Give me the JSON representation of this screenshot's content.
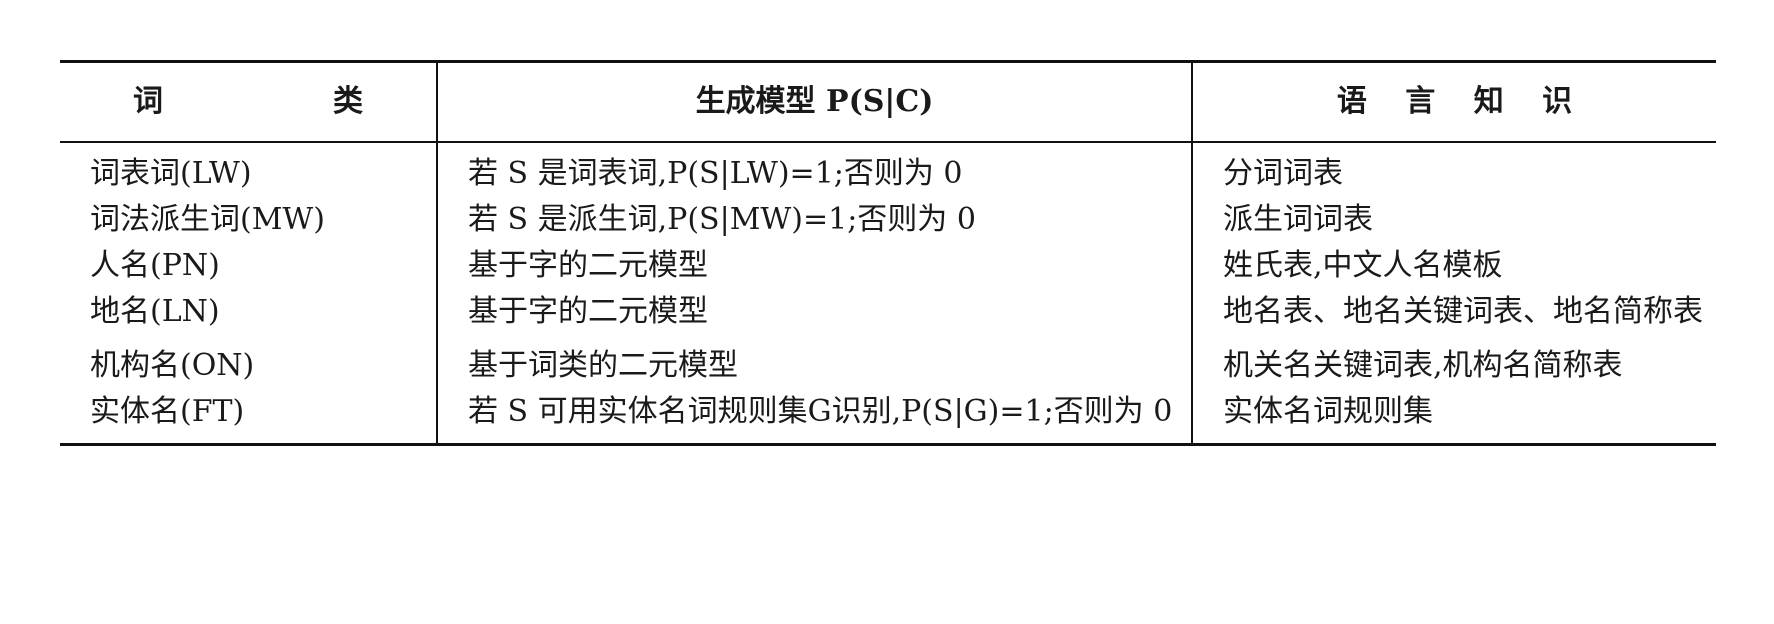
{
  "table": {
    "headers": [
      "词　类",
      "生成模型 P(S|C)",
      "语 言 知 识"
    ],
    "rows": [
      {
        "word_class": "词表词(LW)",
        "model": "若 S 是词表词,P(S|LW)=1;否则为 0",
        "knowledge": "分词词表"
      },
      {
        "word_class": "词法派生词(MW)",
        "model": "若 S 是派生词,P(S|MW)=1;否则为 0",
        "knowledge": "派生词词表"
      },
      {
        "word_class": "人名(PN)",
        "model": "基于字的二元模型",
        "knowledge": "姓氏表,中文人名模板"
      },
      {
        "word_class": "地名(LN)",
        "model": "基于字的二元模型",
        "knowledge": "地名表、地名关键词表、地名简称表"
      },
      {
        "word_class": "机构名(ON)",
        "model": "基于词类的二元模型",
        "knowledge": "机关名关键词表,机构名简称表"
      },
      {
        "word_class": "实体名(FT)",
        "model": "若 S 可用实体名词规则集G识别,P(S|G)=1;否则为 0",
        "knowledge": "实体名词规则集"
      }
    ]
  }
}
